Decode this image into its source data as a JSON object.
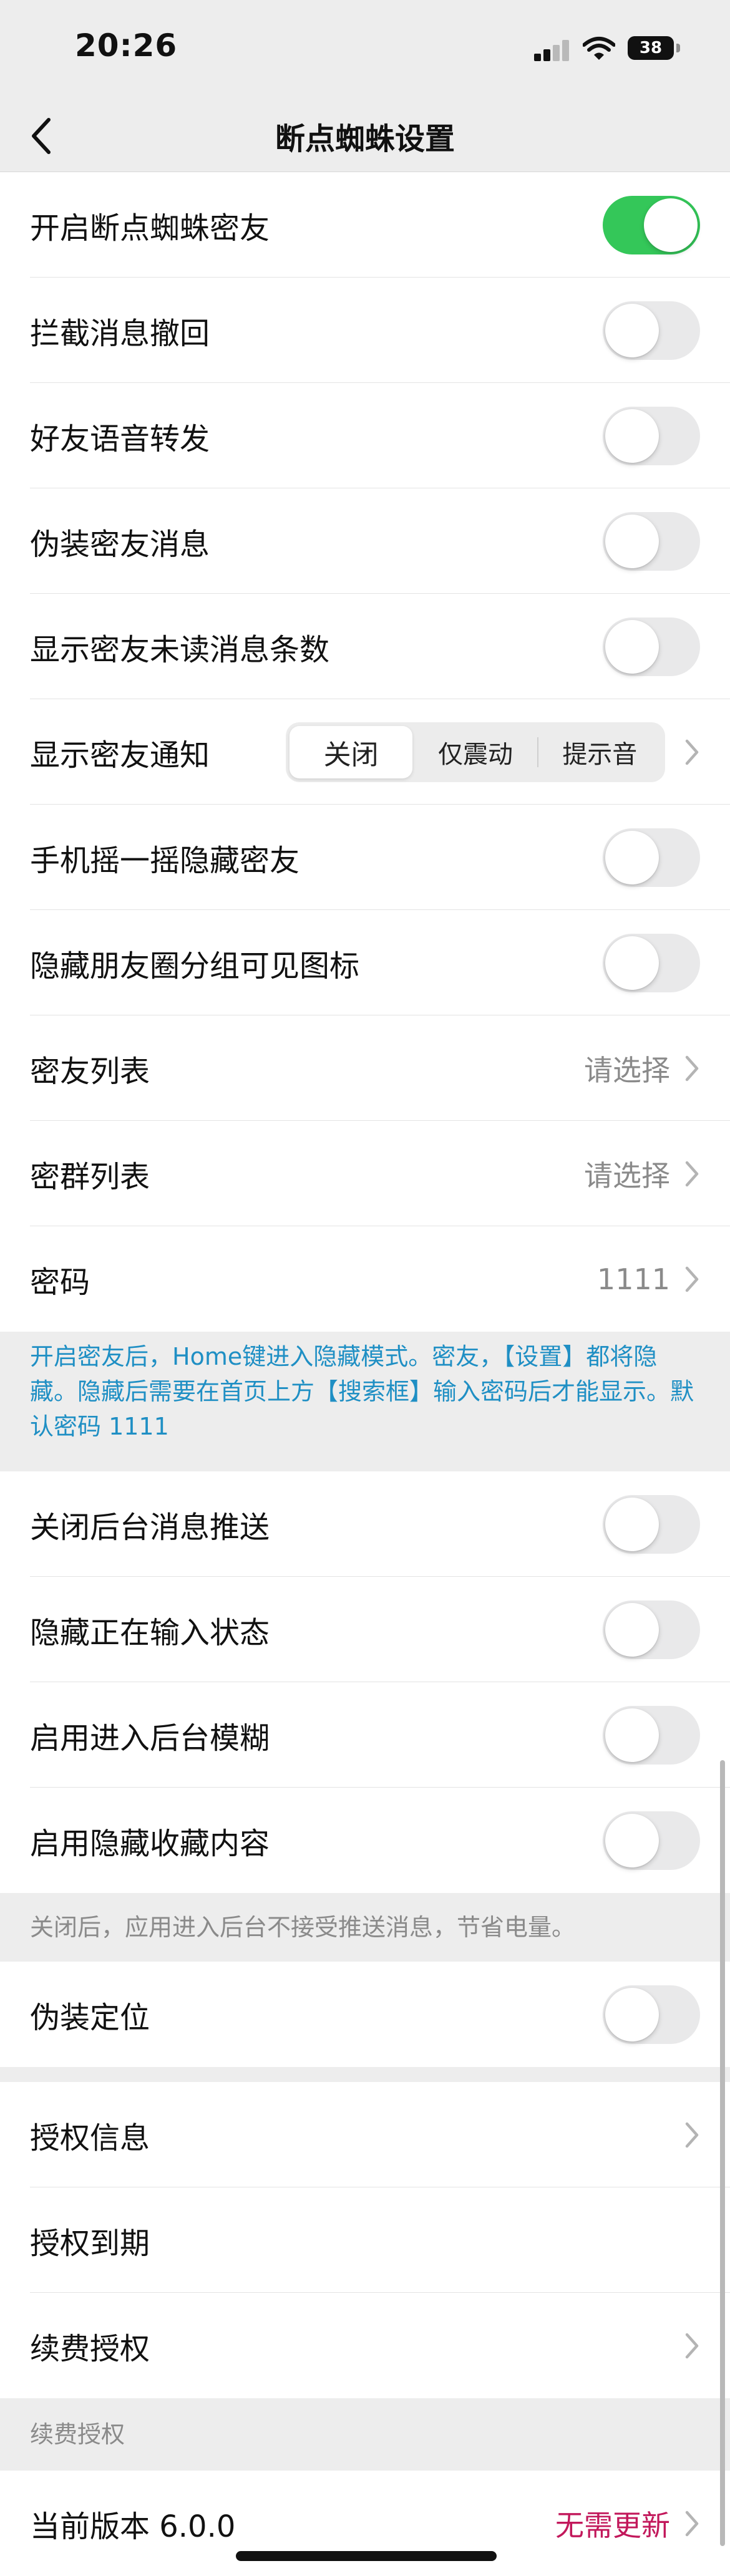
{
  "status": {
    "time": "20:26",
    "battery": "38"
  },
  "nav": {
    "title": "断点蜘蛛设置"
  },
  "rows": {
    "enable_spider": "开启断点蜘蛛密友",
    "intercept_recall": "拦截消息撤回",
    "voice_forward": "好友语音转发",
    "disguise_msg": "伪装密友消息",
    "show_unread": "显示密友未读消息条数",
    "show_notify": "显示密友通知",
    "shake_hide": "手机摇一摇隐藏密友",
    "hide_moments_icon": "隐藏朋友圈分组可见图标",
    "friend_list": "密友列表",
    "friend_list_value": "请选择",
    "group_list": "密群列表",
    "group_list_value": "请选择",
    "password": "密码",
    "password_value": "1111",
    "close_push": "关闭后台消息推送",
    "hide_typing": "隐藏正在输入状态",
    "blur_bg": "启用进入后台模糊",
    "hide_favorites": "启用隐藏收藏内容",
    "fake_location": "伪装定位",
    "auth_info": "授权信息",
    "auth_expire": "授权到期",
    "renew": "续费授权",
    "version": "当前版本 6.0.0",
    "version_value": "无需更新"
  },
  "segment": {
    "options": [
      "关闭",
      "仅震动",
      "提示音"
    ],
    "selected": "关闭"
  },
  "toggles": {
    "enable_spider": true,
    "intercept_recall": false,
    "voice_forward": false,
    "disguise_msg": false,
    "show_unread": false,
    "shake_hide": false,
    "hide_moments_icon": false,
    "close_push": false,
    "hide_typing": false,
    "blur_bg": false,
    "hide_favorites": false,
    "fake_location": false
  },
  "notes": {
    "hidden_mode": "开启密友后，Home键进入隐藏模式。密友，【设置】都将隐藏。隐藏后需要在首页上方【搜索框】输入密码后才能显示。默认密码 1111",
    "push_note": "关闭后，应用进入后台不接受推送消息，节省电量。",
    "renew_note": "续费授权"
  },
  "colors": {
    "toggle_on": "#34c759",
    "note_blue": "#1f8fc4",
    "version_red": "#c2185b",
    "background": "#ededed"
  },
  "icons": {
    "back": "chevron-left-icon",
    "row_arrow": "chevron-right-icon",
    "wifi": "wifi-icon",
    "signal": "signal-icon",
    "battery": "battery-icon"
  }
}
